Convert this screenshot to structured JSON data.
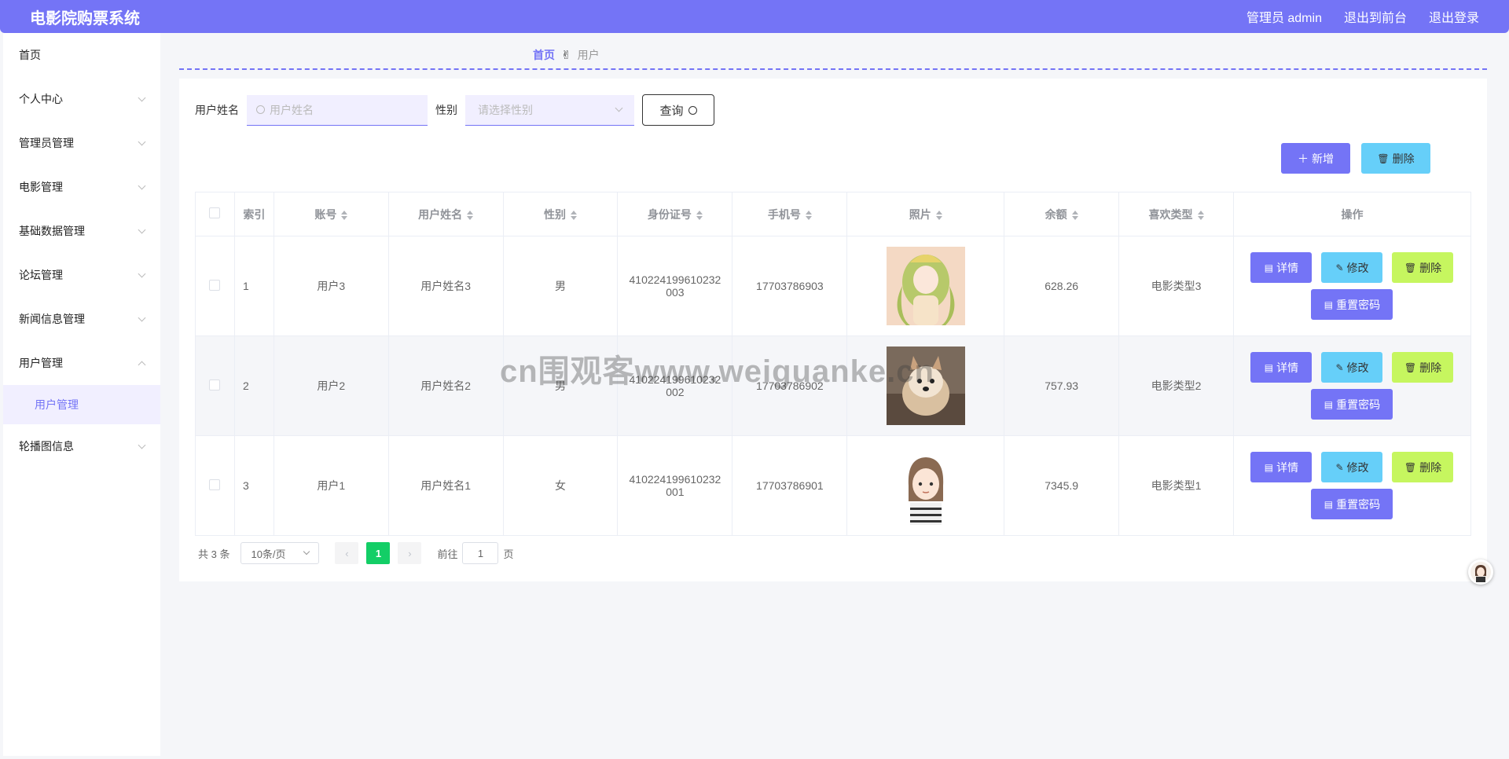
{
  "header": {
    "title": "电影院购票系统",
    "admin_label": "管理员 admin",
    "front_label": "退出到前台",
    "logout_label": "退出登录"
  },
  "sidebar": {
    "items": [
      {
        "label": "首页"
      },
      {
        "label": "个人中心"
      },
      {
        "label": "管理员管理"
      },
      {
        "label": "电影管理"
      },
      {
        "label": "基础数据管理"
      },
      {
        "label": "论坛管理"
      },
      {
        "label": "新闻信息管理"
      },
      {
        "label": "用户管理"
      },
      {
        "label": "轮播图信息"
      }
    ],
    "sub_item": "用户管理"
  },
  "breadcrumb": {
    "home": "首页",
    "current": "用户"
  },
  "search": {
    "name_label": "用户姓名",
    "name_placeholder": "用户姓名",
    "gender_label": "性别",
    "gender_placeholder": "请选择性别",
    "query_button": "查询"
  },
  "toolbar": {
    "add_label": "新增",
    "delete_label": "删除"
  },
  "table": {
    "columns": [
      "索引",
      "账号",
      "用户姓名",
      "性别",
      "身份证号",
      "手机号",
      "照片",
      "余额",
      "喜欢类型",
      "操作"
    ],
    "rows": [
      {
        "index": "1",
        "account": "用户3",
        "name": "用户姓名3",
        "gender": "男",
        "id_line1": "410224199610232",
        "id_line2": "003",
        "phone": "17703786903",
        "photo": "anime-girl-photo",
        "balance": "628.26",
        "type": "电影类型3"
      },
      {
        "index": "2",
        "account": "用户2",
        "name": "用户姓名2",
        "gender": "男",
        "id_line1": "410224199610232",
        "id_line2": "002",
        "phone": "17703786902",
        "photo": "dog-photo",
        "balance": "757.93",
        "type": "电影类型2"
      },
      {
        "index": "3",
        "account": "用户1",
        "name": "用户姓名1",
        "gender": "女",
        "id_line1": "410224199610232",
        "id_line2": "001",
        "phone": "17703786901",
        "photo": "cartoon-girl-photo",
        "balance": "7345.9",
        "type": "电影类型1"
      }
    ],
    "actions": {
      "detail": "详情",
      "edit": "修改",
      "delete": "删除",
      "reset": "重置密码"
    }
  },
  "pagination": {
    "total": "共 3 条",
    "page_size": "10条/页",
    "current": "1",
    "goto_prefix": "前往",
    "goto_value": "1",
    "goto_suffix": "页"
  },
  "watermark": "cn围观客www.weiguanke.cn",
  "colors": {
    "primary": "#7474f6",
    "info": "#66cff9",
    "lime": "#c6f65f",
    "pager_active": "#13ce66"
  }
}
